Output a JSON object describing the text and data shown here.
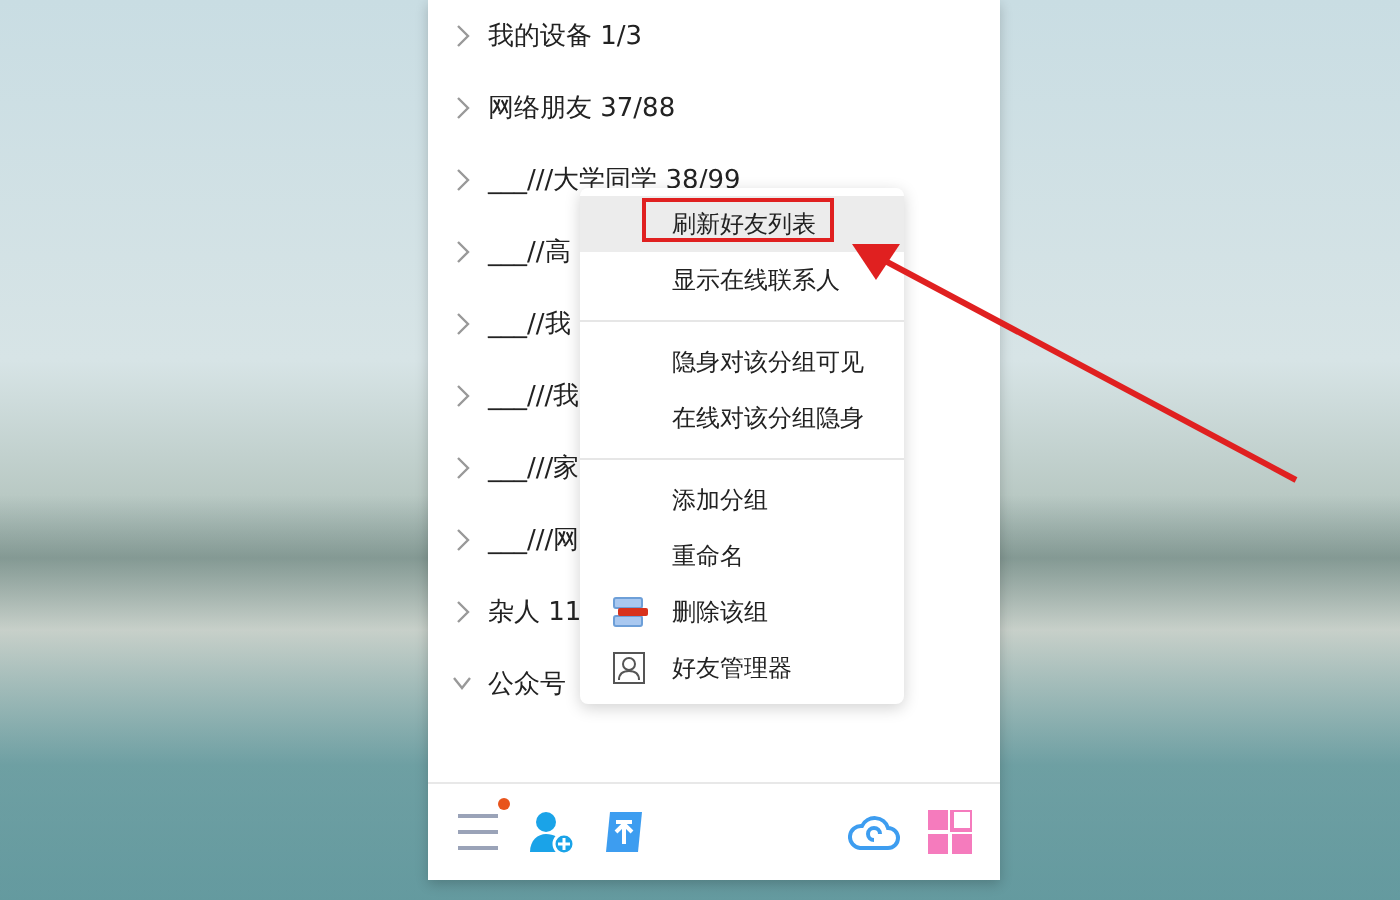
{
  "groups": [
    {
      "name": "我的设备",
      "count": "1/3",
      "expanded": false
    },
    {
      "name": "网络朋友",
      "count": "37/88",
      "expanded": false
    },
    {
      "name": "___///大学同学",
      "count": "38/99",
      "expanded": false
    },
    {
      "name": "___//高",
      "expanded": false
    },
    {
      "name": "___//我",
      "expanded": false
    },
    {
      "name": "___///我",
      "expanded": false
    },
    {
      "name": "___///家",
      "expanded": false
    },
    {
      "name": "___///网",
      "expanded": false
    },
    {
      "name": "杂人",
      "count": "11",
      "expanded": false
    },
    {
      "name": "公众号",
      "expanded": true
    }
  ],
  "context_menu": [
    [
      {
        "label": "刷新好友列表",
        "kind": "plain",
        "selected": true
      },
      {
        "label": "显示在线联系人",
        "kind": "plain",
        "selected": false
      }
    ],
    [
      {
        "label": "隐身对该分组可见",
        "kind": "plain",
        "selected": false
      },
      {
        "label": "在线对该分组隐身",
        "kind": "plain",
        "selected": false
      }
    ],
    [
      {
        "label": "添加分组",
        "kind": "plain",
        "selected": false
      },
      {
        "label": "重命名",
        "kind": "plain",
        "selected": false
      },
      {
        "label": "删除该组",
        "kind": "delete",
        "selected": false
      },
      {
        "label": "好友管理器",
        "kind": "manager",
        "selected": false
      }
    ]
  ],
  "footer": {
    "menu_badge": true
  }
}
